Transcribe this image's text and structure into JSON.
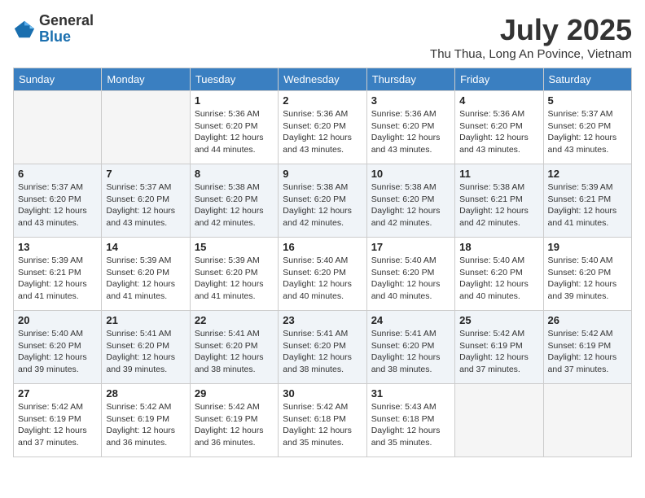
{
  "logo": {
    "general": "General",
    "blue": "Blue"
  },
  "title": {
    "month_year": "July 2025",
    "location": "Thu Thua, Long An Povince, Vietnam"
  },
  "headers": [
    "Sunday",
    "Monday",
    "Tuesday",
    "Wednesday",
    "Thursday",
    "Friday",
    "Saturday"
  ],
  "weeks": [
    [
      {
        "day": "",
        "sunrise": "",
        "sunset": "",
        "daylight": ""
      },
      {
        "day": "",
        "sunrise": "",
        "sunset": "",
        "daylight": ""
      },
      {
        "day": "1",
        "sunrise": "Sunrise: 5:36 AM",
        "sunset": "Sunset: 6:20 PM",
        "daylight": "Daylight: 12 hours and 44 minutes."
      },
      {
        "day": "2",
        "sunrise": "Sunrise: 5:36 AM",
        "sunset": "Sunset: 6:20 PM",
        "daylight": "Daylight: 12 hours and 43 minutes."
      },
      {
        "day": "3",
        "sunrise": "Sunrise: 5:36 AM",
        "sunset": "Sunset: 6:20 PM",
        "daylight": "Daylight: 12 hours and 43 minutes."
      },
      {
        "day": "4",
        "sunrise": "Sunrise: 5:36 AM",
        "sunset": "Sunset: 6:20 PM",
        "daylight": "Daylight: 12 hours and 43 minutes."
      },
      {
        "day": "5",
        "sunrise": "Sunrise: 5:37 AM",
        "sunset": "Sunset: 6:20 PM",
        "daylight": "Daylight: 12 hours and 43 minutes."
      }
    ],
    [
      {
        "day": "6",
        "sunrise": "Sunrise: 5:37 AM",
        "sunset": "Sunset: 6:20 PM",
        "daylight": "Daylight: 12 hours and 43 minutes."
      },
      {
        "day": "7",
        "sunrise": "Sunrise: 5:37 AM",
        "sunset": "Sunset: 6:20 PM",
        "daylight": "Daylight: 12 hours and 43 minutes."
      },
      {
        "day": "8",
        "sunrise": "Sunrise: 5:38 AM",
        "sunset": "Sunset: 6:20 PM",
        "daylight": "Daylight: 12 hours and 42 minutes."
      },
      {
        "day": "9",
        "sunrise": "Sunrise: 5:38 AM",
        "sunset": "Sunset: 6:20 PM",
        "daylight": "Daylight: 12 hours and 42 minutes."
      },
      {
        "day": "10",
        "sunrise": "Sunrise: 5:38 AM",
        "sunset": "Sunset: 6:20 PM",
        "daylight": "Daylight: 12 hours and 42 minutes."
      },
      {
        "day": "11",
        "sunrise": "Sunrise: 5:38 AM",
        "sunset": "Sunset: 6:21 PM",
        "daylight": "Daylight: 12 hours and 42 minutes."
      },
      {
        "day": "12",
        "sunrise": "Sunrise: 5:39 AM",
        "sunset": "Sunset: 6:21 PM",
        "daylight": "Daylight: 12 hours and 41 minutes."
      }
    ],
    [
      {
        "day": "13",
        "sunrise": "Sunrise: 5:39 AM",
        "sunset": "Sunset: 6:21 PM",
        "daylight": "Daylight: 12 hours and 41 minutes."
      },
      {
        "day": "14",
        "sunrise": "Sunrise: 5:39 AM",
        "sunset": "Sunset: 6:20 PM",
        "daylight": "Daylight: 12 hours and 41 minutes."
      },
      {
        "day": "15",
        "sunrise": "Sunrise: 5:39 AM",
        "sunset": "Sunset: 6:20 PM",
        "daylight": "Daylight: 12 hours and 41 minutes."
      },
      {
        "day": "16",
        "sunrise": "Sunrise: 5:40 AM",
        "sunset": "Sunset: 6:20 PM",
        "daylight": "Daylight: 12 hours and 40 minutes."
      },
      {
        "day": "17",
        "sunrise": "Sunrise: 5:40 AM",
        "sunset": "Sunset: 6:20 PM",
        "daylight": "Daylight: 12 hours and 40 minutes."
      },
      {
        "day": "18",
        "sunrise": "Sunrise: 5:40 AM",
        "sunset": "Sunset: 6:20 PM",
        "daylight": "Daylight: 12 hours and 40 minutes."
      },
      {
        "day": "19",
        "sunrise": "Sunrise: 5:40 AM",
        "sunset": "Sunset: 6:20 PM",
        "daylight": "Daylight: 12 hours and 39 minutes."
      }
    ],
    [
      {
        "day": "20",
        "sunrise": "Sunrise: 5:40 AM",
        "sunset": "Sunset: 6:20 PM",
        "daylight": "Daylight: 12 hours and 39 minutes."
      },
      {
        "day": "21",
        "sunrise": "Sunrise: 5:41 AM",
        "sunset": "Sunset: 6:20 PM",
        "daylight": "Daylight: 12 hours and 39 minutes."
      },
      {
        "day": "22",
        "sunrise": "Sunrise: 5:41 AM",
        "sunset": "Sunset: 6:20 PM",
        "daylight": "Daylight: 12 hours and 38 minutes."
      },
      {
        "day": "23",
        "sunrise": "Sunrise: 5:41 AM",
        "sunset": "Sunset: 6:20 PM",
        "daylight": "Daylight: 12 hours and 38 minutes."
      },
      {
        "day": "24",
        "sunrise": "Sunrise: 5:41 AM",
        "sunset": "Sunset: 6:20 PM",
        "daylight": "Daylight: 12 hours and 38 minutes."
      },
      {
        "day": "25",
        "sunrise": "Sunrise: 5:42 AM",
        "sunset": "Sunset: 6:19 PM",
        "daylight": "Daylight: 12 hours and 37 minutes."
      },
      {
        "day": "26",
        "sunrise": "Sunrise: 5:42 AM",
        "sunset": "Sunset: 6:19 PM",
        "daylight": "Daylight: 12 hours and 37 minutes."
      }
    ],
    [
      {
        "day": "27",
        "sunrise": "Sunrise: 5:42 AM",
        "sunset": "Sunset: 6:19 PM",
        "daylight": "Daylight: 12 hours and 37 minutes."
      },
      {
        "day": "28",
        "sunrise": "Sunrise: 5:42 AM",
        "sunset": "Sunset: 6:19 PM",
        "daylight": "Daylight: 12 hours and 36 minutes."
      },
      {
        "day": "29",
        "sunrise": "Sunrise: 5:42 AM",
        "sunset": "Sunset: 6:19 PM",
        "daylight": "Daylight: 12 hours and 36 minutes."
      },
      {
        "day": "30",
        "sunrise": "Sunrise: 5:42 AM",
        "sunset": "Sunset: 6:18 PM",
        "daylight": "Daylight: 12 hours and 35 minutes."
      },
      {
        "day": "31",
        "sunrise": "Sunrise: 5:43 AM",
        "sunset": "Sunset: 6:18 PM",
        "daylight": "Daylight: 12 hours and 35 minutes."
      },
      {
        "day": "",
        "sunrise": "",
        "sunset": "",
        "daylight": ""
      },
      {
        "day": "",
        "sunrise": "",
        "sunset": "",
        "daylight": ""
      }
    ]
  ]
}
